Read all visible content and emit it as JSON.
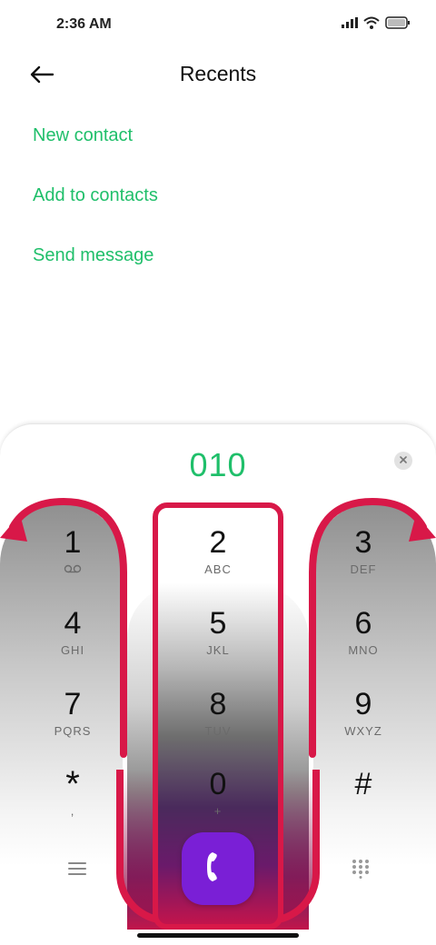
{
  "status_bar": {
    "time": "2:36 AM"
  },
  "header": {
    "title": "Recents"
  },
  "actions": [
    {
      "label": "New contact"
    },
    {
      "label": "Add to contacts"
    },
    {
      "label": "Send message"
    }
  ],
  "dialer": {
    "number": "010",
    "keys": [
      {
        "digit": "1",
        "letters": "voicemail-icon"
      },
      {
        "digit": "2",
        "letters": "ABC"
      },
      {
        "digit": "3",
        "letters": "DEF"
      },
      {
        "digit": "4",
        "letters": "GHI"
      },
      {
        "digit": "5",
        "letters": "JKL"
      },
      {
        "digit": "6",
        "letters": "MNO"
      },
      {
        "digit": "7",
        "letters": "PQRS"
      },
      {
        "digit": "8",
        "letters": "TUV"
      },
      {
        "digit": "9",
        "letters": "WXYZ"
      },
      {
        "digit": "*",
        "letters": ","
      },
      {
        "digit": "0",
        "letters": "+"
      },
      {
        "digit": "#",
        "letters": ""
      }
    ]
  },
  "colors": {
    "accent_green": "#1fbf6a",
    "call_button": "#7a1fd6",
    "highlight_red": "#d81848"
  },
  "icons": {
    "back": "back-arrow-icon",
    "clear": "close-icon",
    "menu": "menu-icon",
    "call": "phone-icon",
    "keypad": "keypad-icon"
  }
}
